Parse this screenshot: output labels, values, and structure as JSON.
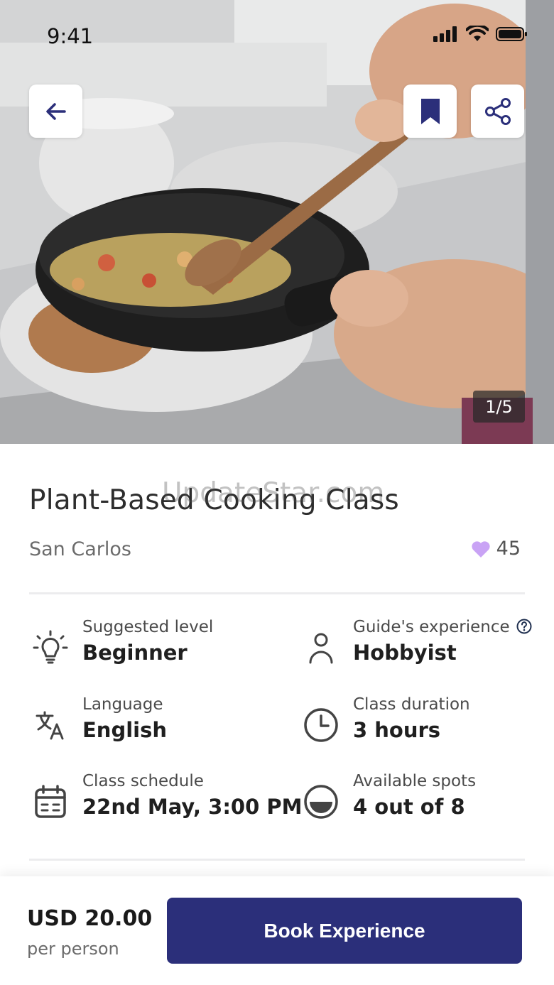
{
  "status_bar": {
    "time": "9:41"
  },
  "hero": {
    "image_counter": "1/5"
  },
  "experience": {
    "title": "Plant-Based Cooking Class",
    "location": "San Carlos",
    "likes": "45",
    "watermark": "UpdateStar.com"
  },
  "details": [
    {
      "label": "Suggested level",
      "value": "Beginner",
      "icon": "lightbulb-icon"
    },
    {
      "label": "Guide's experience",
      "value": "Hobbyist",
      "icon": "person-icon"
    },
    {
      "label": "Language",
      "value": "English",
      "icon": "translate-icon"
    },
    {
      "label": "Class duration",
      "value": "3 hours",
      "icon": "clock-icon"
    },
    {
      "label": "Class schedule",
      "value": "22nd May, 3:00 PM",
      "icon": "calendar-icon"
    },
    {
      "label": "Available spots",
      "value": "4 out of 8",
      "icon": "half-circle-icon"
    }
  ],
  "footer": {
    "price": "USD 20.00",
    "per": "per person",
    "book_label": "Book Experience"
  },
  "colors": {
    "accent": "#2b2f7a",
    "heart": "#c9a3f5"
  }
}
